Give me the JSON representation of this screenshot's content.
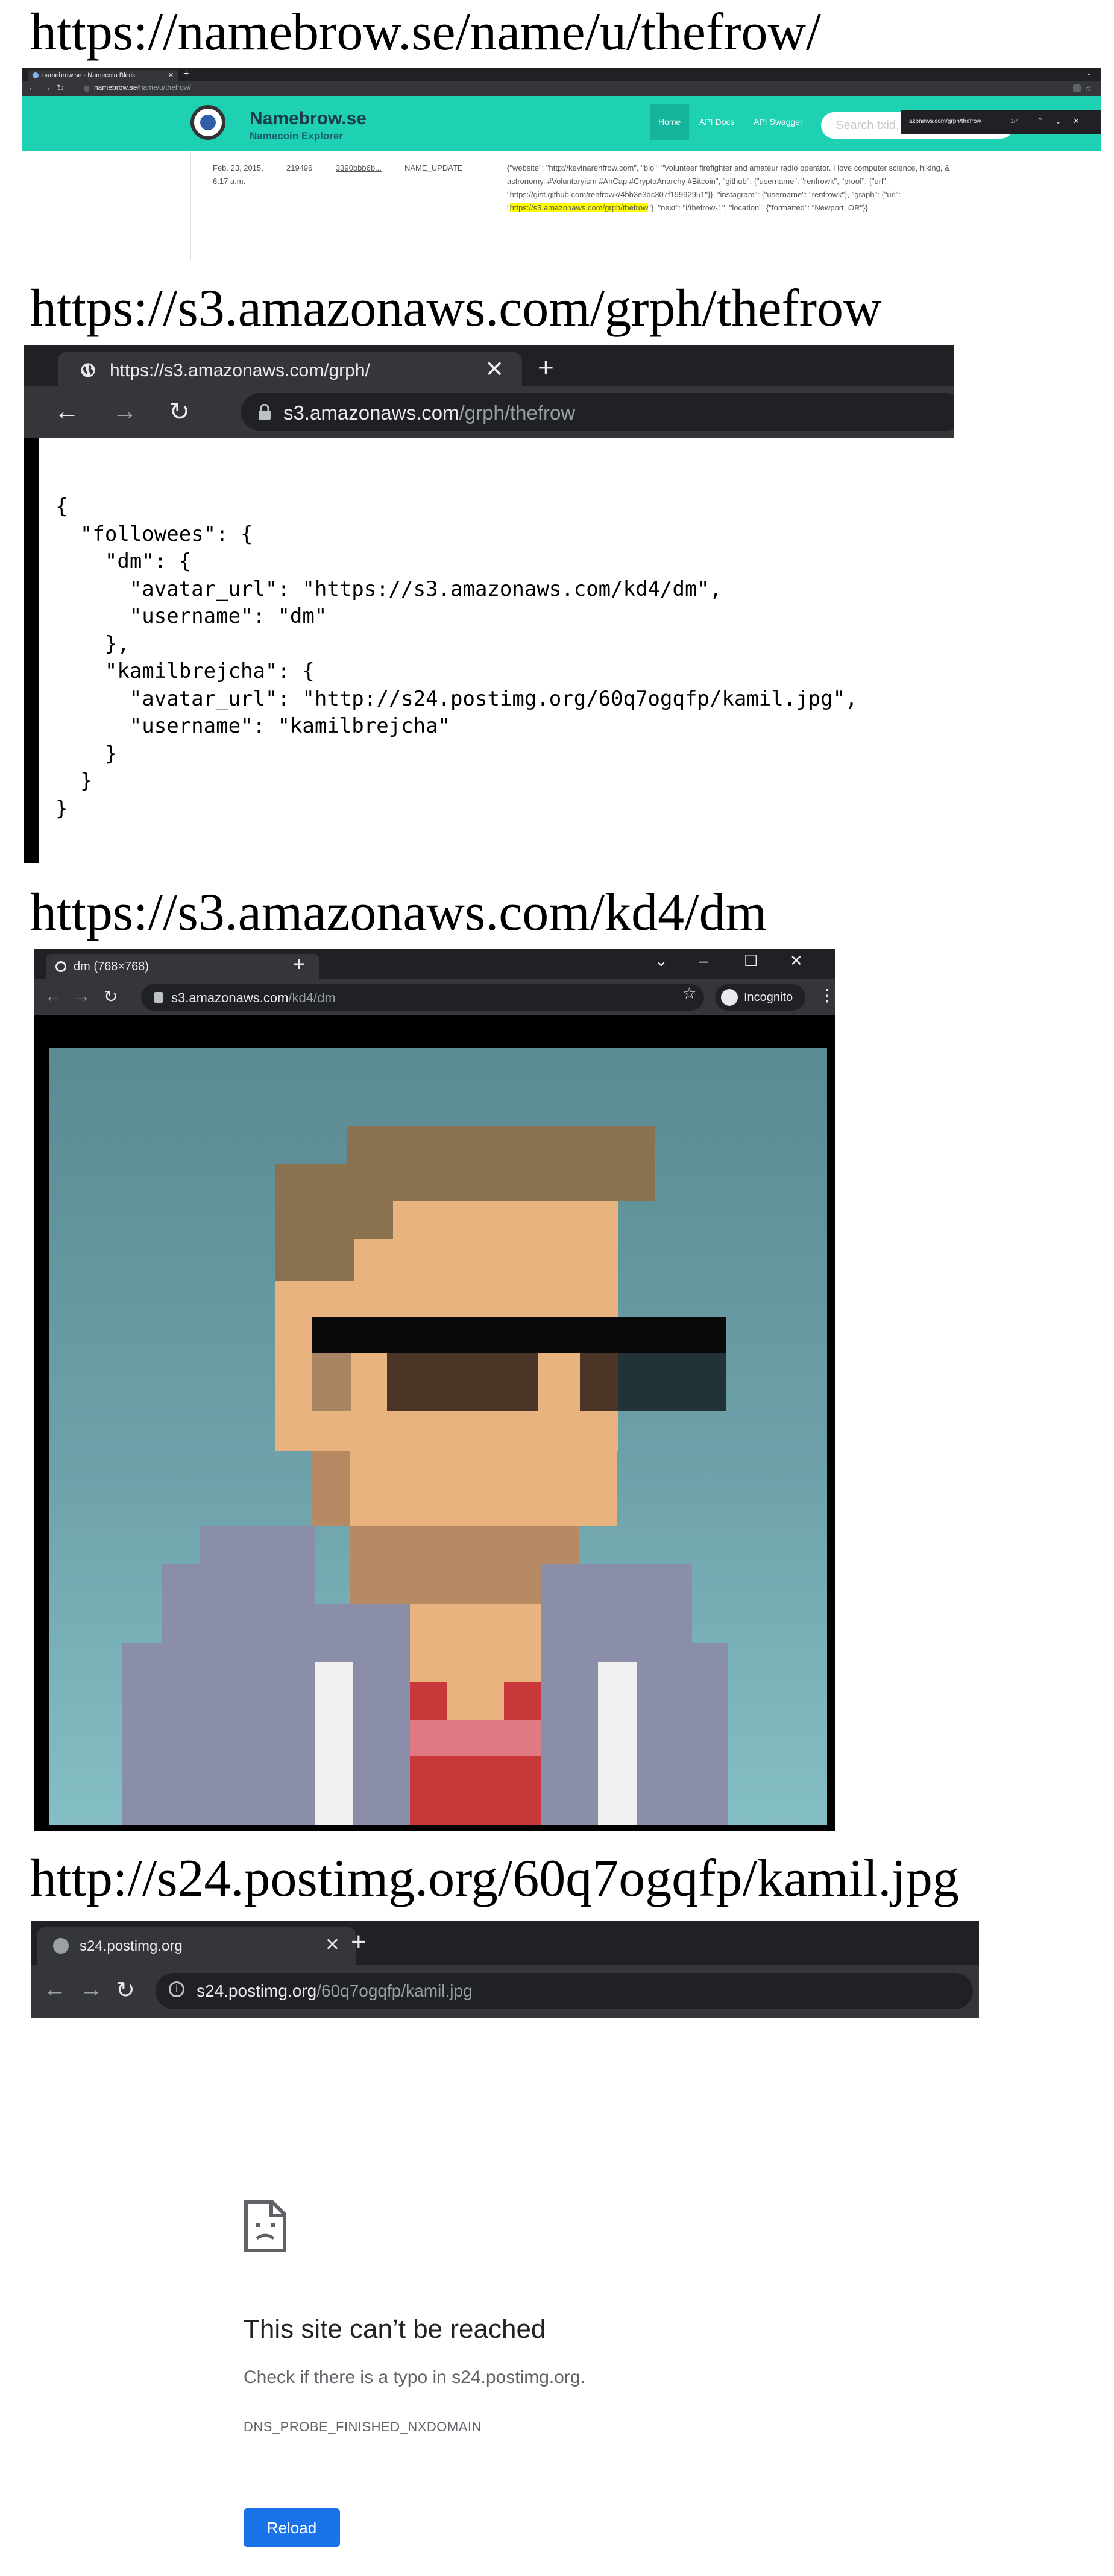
{
  "captions": {
    "c1": "https://namebrow.se/name/u/thefrow/",
    "c2": "https://s3.amazonaws.com/grph/thefrow",
    "c3": "https://s3.amazonaws.com/kd4/dm",
    "c4": "http://s24.postimg.org/60q7ogqfp/kamil.jpg"
  },
  "namebrow": {
    "tab_title": "namebrow.se - Namecoin Block",
    "url_host": "namebrow.se",
    "url_path": "/name/u/thefrow/",
    "brand": "Namebrow.se",
    "brand_sub": "Namecoin Explorer",
    "nav": [
      "Home",
      "API Docs",
      "API Swagger"
    ],
    "search_placeholder": "Search txid, name etc",
    "find_text": "azonaws.com/grph/thefrow",
    "find_count": "1/4",
    "row": {
      "date": "Feb. 23, 2015, 6:17 a.m.",
      "height": "219496",
      "txid": "3390bbb6b...",
      "op": "NAME_UPDATE",
      "value_before": "{\"website\": \"http://kevinarenfrow.com\", \"bio\": \"Volunteer firefighter and amateur radio operator. I love computer science, hiking, & astronomy. #Voluntaryism #AnCap #CryptoAnarchy #Bitcoin\", \"github\": {\"username\": \"renfrowk\", \"proof\": {\"url\": \"https://gist.github.com/renfrowk/4bb3e3dc307f19992951\"}}, \"instagram\": {\"username\": \"renfrowk\"}, \"graph\": {\"url\": \"",
      "value_highlight": "https://s3.amazonaws.com/grph/thefrow",
      "value_after": "\"}, \"next\": \"i/thefrow-1\", \"location\": {\"formatted\": \"Newport, OR\"}}"
    }
  },
  "grph": {
    "tab_title": "https://s3.amazonaws.com/grph/",
    "url_host": "s3.amazonaws.com",
    "url_path": "/grph/thefrow",
    "json_text": "{\n  \"followees\": {\n    \"dm\": {\n      \"avatar_url\": \"https://s3.amazonaws.com/kd4/dm\",\n      \"username\": \"dm\"\n    },\n    \"kamilbrejcha\": {\n      \"avatar_url\": \"http://s24.postimg.org/60q7ogqfp/kamil.jpg\",\n      \"username\": \"kamilbrejcha\"\n    }\n  }\n}"
  },
  "dm": {
    "tab_title": "dm (768×768)",
    "url_host": "s3.amazonaws.com",
    "url_path": "/kd4/dm",
    "incognito_label": "Incognito"
  },
  "kamil": {
    "tab_title": "s24.postimg.org",
    "url_host": "s24.postimg.org",
    "url_path": "/60q7ogqfp/kamil.jpg",
    "error_title": "This site can’t be reached",
    "error_body": "Check if there is a typo in s24.postimg.org.",
    "error_code": "DNS_PROBE_FINISHED_NXDOMAIN",
    "reload_label": "Reload"
  },
  "colors": {
    "namebrow_teal": "#1ed1b3",
    "chrome_dark": "#202124",
    "chrome_toolbar": "#35363a",
    "reload_blue": "#1a73e8",
    "highlight": "#ffff00"
  }
}
